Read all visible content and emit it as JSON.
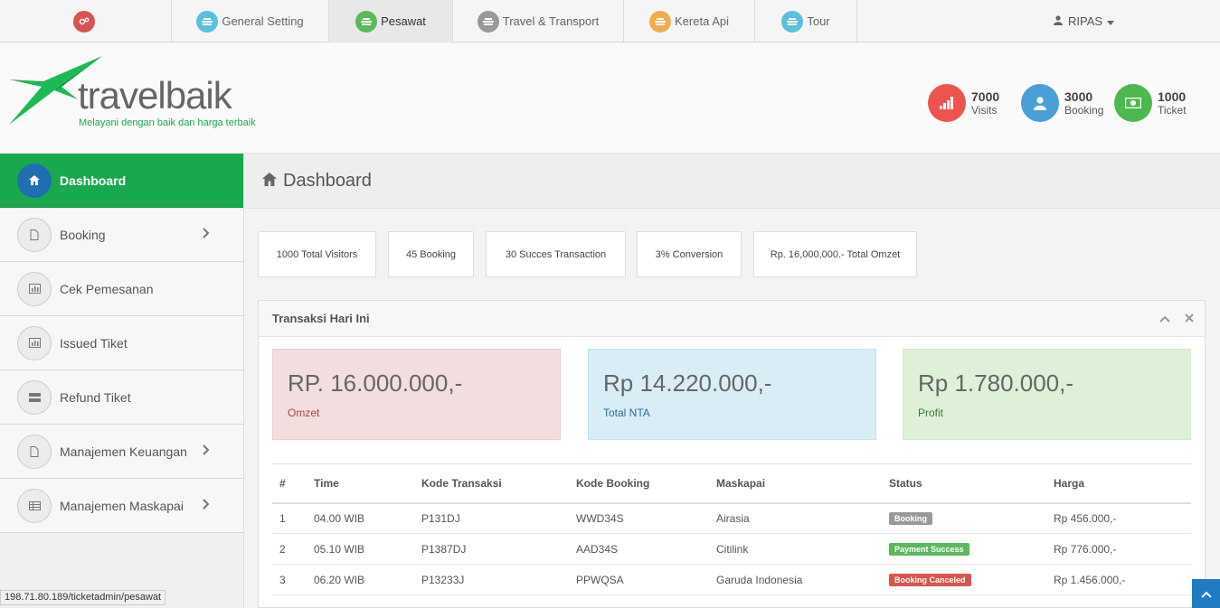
{
  "topnav": {
    "items": [
      {
        "label": "",
        "color": "#d9534f",
        "icon": "cogs-icon"
      },
      {
        "label": "General Setting",
        "color": "#5bc0de",
        "icon": "list-icon"
      },
      {
        "label": "Pesawat",
        "color": "#5cb85c",
        "icon": "list-icon"
      },
      {
        "label": "Travel & Transport",
        "color": "#999999",
        "icon": "list-icon"
      },
      {
        "label": "Kereta Api",
        "color": "#f0ad4e",
        "icon": "list-icon"
      },
      {
        "label": "Tour",
        "color": "#5bc0de",
        "icon": "list-icon"
      }
    ],
    "user": "RIPAS"
  },
  "header": {
    "logo_text": "travelbaik",
    "tagline": "Melayani dengan baik dan harga terbaik",
    "stats": [
      {
        "num": "7000",
        "label": "Visits",
        "color": "#ef5350",
        "icon": "signal-icon"
      },
      {
        "num": "3000",
        "label": "Booking",
        "color": "#4a9fd6",
        "icon": "user-icon"
      },
      {
        "num": "1000",
        "label": "Ticket",
        "color": "#4fb74f",
        "icon": "money-icon"
      }
    ]
  },
  "sidebar": {
    "items": [
      {
        "label": "Dashboard",
        "icon": "home-icon"
      },
      {
        "label": "Booking",
        "icon": "file-icon"
      },
      {
        "label": "Cek Pemesanan",
        "icon": "chart-icon"
      },
      {
        "label": "Issued Tiket",
        "icon": "chart-icon"
      },
      {
        "label": "Refund Tiket",
        "icon": "hdd-icon"
      },
      {
        "label": "Manajemen Keuangan",
        "icon": "file-icon"
      },
      {
        "label": "Manajemen Maskapai",
        "icon": "table-icon"
      }
    ]
  },
  "main": {
    "title": "Dashboard",
    "summary": [
      "1000 Total Visitors",
      "45 Booking",
      "30 Succes Transaction",
      "3% Conversion",
      "Rp. 16,000,000.- Total Omzet"
    ],
    "panel_title": "Transaksi Hari Ini",
    "boxes": [
      {
        "amount": "RP. 16.000.000,-",
        "label": "Omzet"
      },
      {
        "amount": "Rp 14.220.000,-",
        "label": "Total NTA"
      },
      {
        "amount": "Rp 1.780.000,-",
        "label": "Profit"
      }
    ],
    "table": {
      "headers": [
        "#",
        "Time",
        "Kode Transaksi",
        "Kode Booking",
        "Maskapai",
        "Status",
        "Harga"
      ],
      "rows": [
        {
          "no": "1",
          "time": "04.00 WIB",
          "kode_transaksi": "P131DJ",
          "kode_booking": "WWD34S",
          "maskapai": "Airasia",
          "status": "Booking",
          "status_color": "#999999",
          "harga": "Rp 456.000,-"
        },
        {
          "no": "2",
          "time": "05.10 WIB",
          "kode_transaksi": "P1387DJ",
          "kode_booking": "AAD34S",
          "maskapai": "Citilink",
          "status": "Payment Success",
          "status_color": "#5cb85c",
          "harga": "Rp 776.000,-"
        },
        {
          "no": "3",
          "time": "06.20 WIB",
          "kode_transaksi": "P13233J",
          "kode_booking": "PPWQSA",
          "maskapai": "Garuda Indonesia",
          "status": "Booking Canceled",
          "status_color": "#d9534f",
          "harga": "Rp 1.456.000,-"
        }
      ]
    }
  },
  "statusbar_url": "198.71.80.189/ticketadmin/pesawat"
}
